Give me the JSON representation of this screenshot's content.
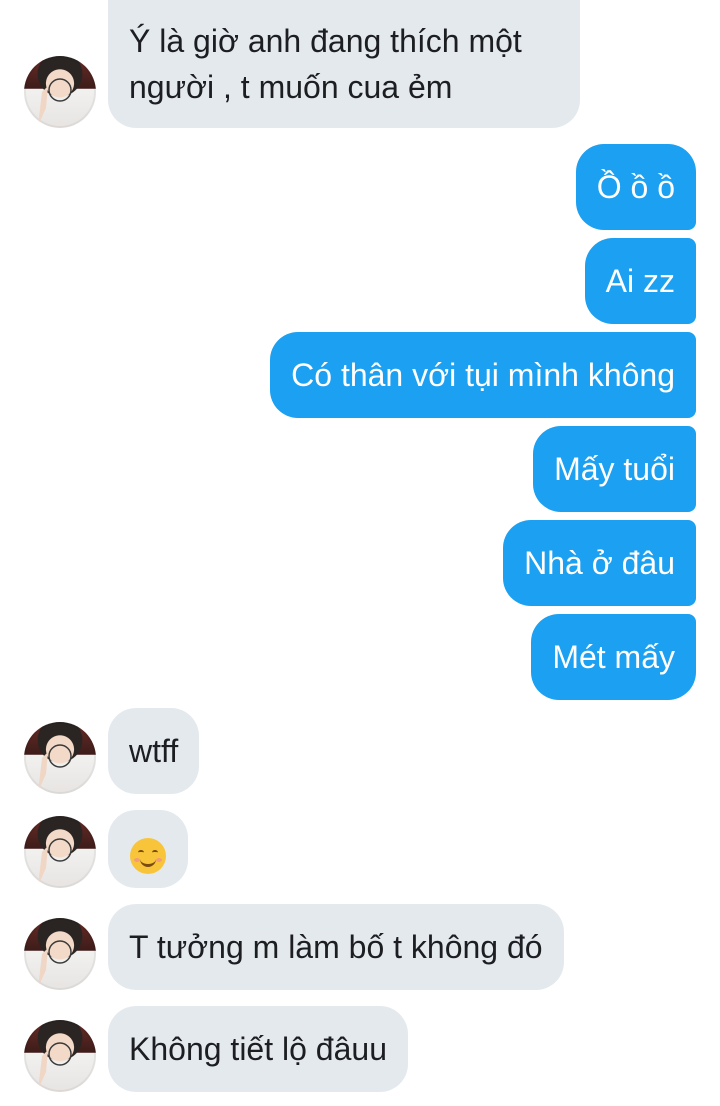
{
  "conversation": {
    "messages": [
      {
        "sender": "contact",
        "text": "Ý là giờ anh đang thích một người , t muốn cua ẻm"
      },
      {
        "sender": "me",
        "text": "Ồ ồ ồ"
      },
      {
        "sender": "me",
        "text": "Ai zz"
      },
      {
        "sender": "me",
        "text": "Có thân với tụi mình không"
      },
      {
        "sender": "me",
        "text": "Mấy tuổi"
      },
      {
        "sender": "me",
        "text": "Nhà ở đâu"
      },
      {
        "sender": "me",
        "text": "Mét mấy"
      },
      {
        "sender": "contact",
        "text": "wtff"
      },
      {
        "sender": "contact",
        "icon": "smiling-face-emoji"
      },
      {
        "sender": "contact",
        "text": "T tưởng m làm bố t không đó"
      },
      {
        "sender": "contact",
        "text": "Không tiết lộ đâuu"
      }
    ],
    "line1": "Ý là giờ anh đang thích một",
    "line2": "người , t muốn cua ẻm"
  },
  "colors": {
    "outgoing_bubble": "#1ba0f2",
    "incoming_bubble": "#e4e9ee",
    "incoming_text": "#1c1e21",
    "outgoing_text": "#ffffff"
  }
}
